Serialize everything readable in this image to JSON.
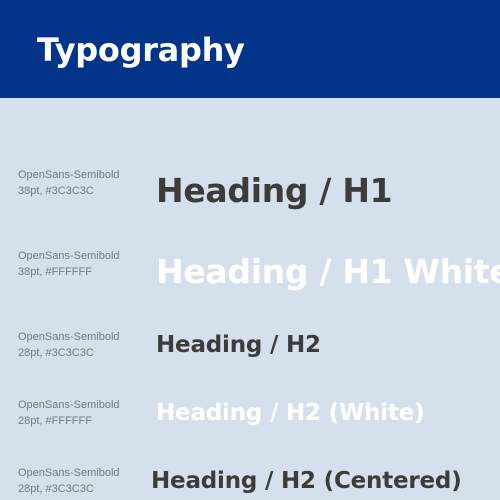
{
  "header": {
    "title": "Typography",
    "background_color": "#02358A"
  },
  "rows": [
    {
      "spec_font": "OpenSans-Semibold",
      "spec_detail": "38pt, #3C3C3C",
      "sample": "Heading / H1",
      "color": "#3C3C3C"
    },
    {
      "spec_font": "OpenSans-Semibold",
      "spec_detail": "38pt, #FFFFFF",
      "sample": "Heading / H1 White",
      "color": "#FFFFFF"
    },
    {
      "spec_font": "OpenSans-Semibold",
      "spec_detail": "28pt, #3C3C3C",
      "sample": "Heading / H2",
      "color": "#3C3C3C"
    },
    {
      "spec_font": "OpenSans-Semibold",
      "spec_detail": "28pt, #FFFFFF",
      "sample": "Heading / H2 (White)",
      "color": "#FFFFFF"
    },
    {
      "spec_font": "OpenSans-Semibold",
      "spec_detail": "28pt, #3C3C3C",
      "sample": "Heading / H2 (Centered)",
      "color": "#3C3C3C"
    }
  ],
  "page": {
    "background_color": "#D5E0EC"
  }
}
